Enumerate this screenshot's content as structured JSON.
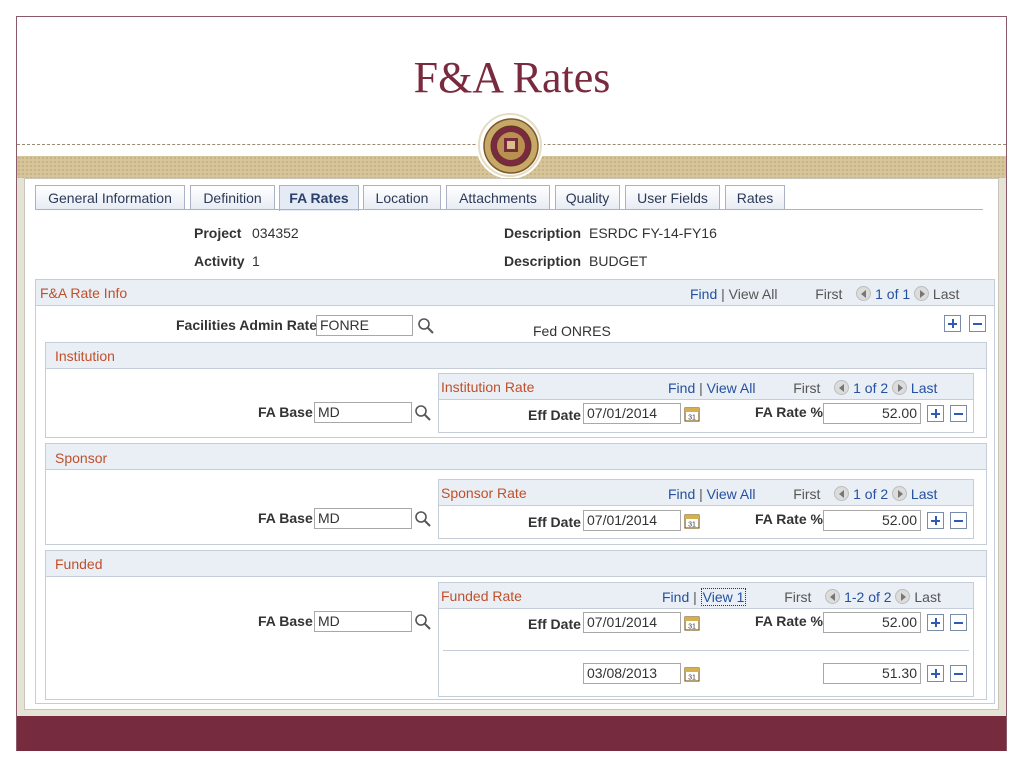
{
  "slide": {
    "title": "F&A Rates"
  },
  "tabs": [
    {
      "label": "General Information"
    },
    {
      "label": "Definition"
    },
    {
      "label": "FA Rates"
    },
    {
      "label": "Location"
    },
    {
      "label": "Attachments"
    },
    {
      "label": "Quality"
    },
    {
      "label": "User Fields"
    },
    {
      "label": "Rates"
    }
  ],
  "header": {
    "project_label": "Project",
    "project_value": "034352",
    "activity_label": "Activity",
    "activity_value": "1",
    "desc1_label": "Description",
    "desc1_value": "ESRDC FY-14-FY16",
    "desc2_label": "Description",
    "desc2_value": "BUDGET"
  },
  "nav": {
    "find": "Find",
    "sep": "|",
    "view_all": "View All",
    "view_1": "View 1",
    "first": "First",
    "last": "Last"
  },
  "rate_info": {
    "title": "F&A Rate Info",
    "count": "1 of 1",
    "facilities_label": "Facilities Admin Rate",
    "facilities_value": "FONRE",
    "facilities_desc": "Fed ONRES"
  },
  "institution": {
    "title": "Institution",
    "fa_base_label": "FA Base",
    "fa_base_value": "MD",
    "rate_title": "Institution Rate",
    "count": "1 of 2",
    "eff_date_label": "Eff Date",
    "eff_date_value": "07/01/2014",
    "fa_rate_label": "FA Rate %",
    "fa_rate_value": "52.00"
  },
  "sponsor": {
    "title": "Sponsor",
    "fa_base_label": "FA Base",
    "fa_base_value": "MD",
    "rate_title": "Sponsor Rate",
    "count": "1 of 2",
    "eff_date_label": "Eff Date",
    "eff_date_value": "07/01/2014",
    "fa_rate_label": "FA Rate %",
    "fa_rate_value": "52.00"
  },
  "funded": {
    "title": "Funded",
    "fa_base_label": "FA Base",
    "fa_base_value": "MD",
    "rate_title": "Funded Rate",
    "count": "1-2 of 2",
    "eff_date_label": "Eff Date",
    "rows": [
      {
        "eff_date": "07/01/2014",
        "fa_rate": "52.00"
      },
      {
        "eff_date": "03/08/2013",
        "fa_rate": "51.30"
      }
    ],
    "fa_rate_label": "FA Rate %"
  },
  "calendar_icon_text": "31"
}
